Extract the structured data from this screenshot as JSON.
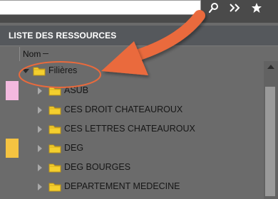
{
  "toolbar": {
    "search_value": "",
    "buttons": [
      {
        "name": "search",
        "icon": "search-icon"
      },
      {
        "name": "forward",
        "icon": "double-chevron-right-icon"
      },
      {
        "name": "favorites",
        "icon": "star-icon"
      }
    ]
  },
  "panel": {
    "title": "LISTE DES RESSOURCES",
    "column_header": "Nom"
  },
  "tree": {
    "root": {
      "label": "Filières",
      "expanded": true,
      "icon": "folder-icon"
    },
    "children": [
      {
        "label": "ASUB",
        "icon": "folder-icon",
        "marker_color": "#f3b9df"
      },
      {
        "label": "CES DROIT CHATEAUROUX",
        "icon": "folder-icon",
        "marker_color": ""
      },
      {
        "label": "CES LETTRES CHATEAUROUX",
        "icon": "folder-icon",
        "marker_color": ""
      },
      {
        "label": "DEG",
        "icon": "folder-icon",
        "marker_color": "#f5c341"
      },
      {
        "label": "DEG BOURGES",
        "icon": "folder-icon",
        "marker_color": ""
      },
      {
        "label": "DEPARTEMENT MEDECINE",
        "icon": "folder-icon",
        "marker_color": ""
      }
    ]
  },
  "colors": {
    "folder": "#f4cf2e",
    "annotation": "#ea6a3c",
    "panel_header": "#55585c"
  }
}
